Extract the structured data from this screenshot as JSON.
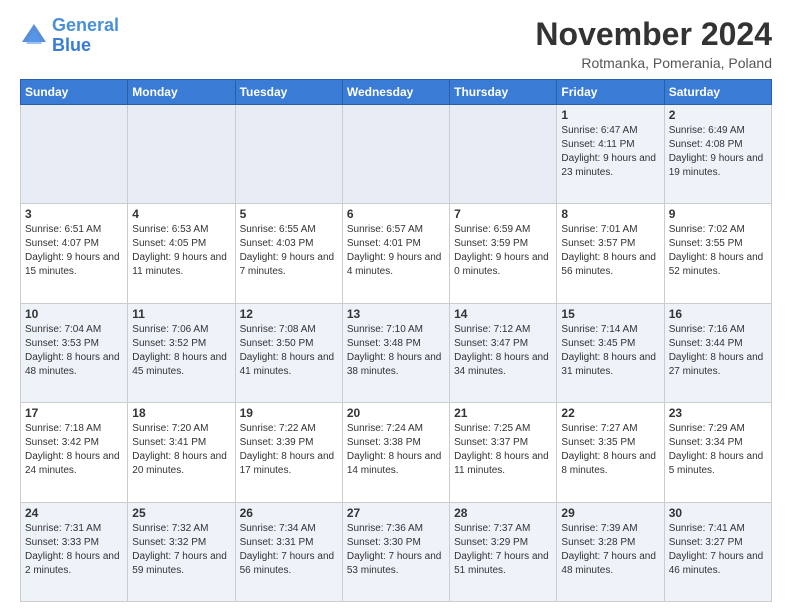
{
  "logo": {
    "line1": "General",
    "line2": "Blue"
  },
  "title": "November 2024",
  "subtitle": "Rotmanka, Pomerania, Poland",
  "weekdays": [
    "Sunday",
    "Monday",
    "Tuesday",
    "Wednesday",
    "Thursday",
    "Friday",
    "Saturday"
  ],
  "rows": [
    [
      {
        "day": "",
        "info": ""
      },
      {
        "day": "",
        "info": ""
      },
      {
        "day": "",
        "info": ""
      },
      {
        "day": "",
        "info": ""
      },
      {
        "day": "",
        "info": ""
      },
      {
        "day": "1",
        "info": "Sunrise: 6:47 AM\nSunset: 4:11 PM\nDaylight: 9 hours\nand 23 minutes."
      },
      {
        "day": "2",
        "info": "Sunrise: 6:49 AM\nSunset: 4:08 PM\nDaylight: 9 hours\nand 19 minutes."
      }
    ],
    [
      {
        "day": "3",
        "info": "Sunrise: 6:51 AM\nSunset: 4:07 PM\nDaylight: 9 hours\nand 15 minutes."
      },
      {
        "day": "4",
        "info": "Sunrise: 6:53 AM\nSunset: 4:05 PM\nDaylight: 9 hours\nand 11 minutes."
      },
      {
        "day": "5",
        "info": "Sunrise: 6:55 AM\nSunset: 4:03 PM\nDaylight: 9 hours\nand 7 minutes."
      },
      {
        "day": "6",
        "info": "Sunrise: 6:57 AM\nSunset: 4:01 PM\nDaylight: 9 hours\nand 4 minutes."
      },
      {
        "day": "7",
        "info": "Sunrise: 6:59 AM\nSunset: 3:59 PM\nDaylight: 9 hours\nand 0 minutes."
      },
      {
        "day": "8",
        "info": "Sunrise: 7:01 AM\nSunset: 3:57 PM\nDaylight: 8 hours\nand 56 minutes."
      },
      {
        "day": "9",
        "info": "Sunrise: 7:02 AM\nSunset: 3:55 PM\nDaylight: 8 hours\nand 52 minutes."
      }
    ],
    [
      {
        "day": "10",
        "info": "Sunrise: 7:04 AM\nSunset: 3:53 PM\nDaylight: 8 hours\nand 48 minutes."
      },
      {
        "day": "11",
        "info": "Sunrise: 7:06 AM\nSunset: 3:52 PM\nDaylight: 8 hours\nand 45 minutes."
      },
      {
        "day": "12",
        "info": "Sunrise: 7:08 AM\nSunset: 3:50 PM\nDaylight: 8 hours\nand 41 minutes."
      },
      {
        "day": "13",
        "info": "Sunrise: 7:10 AM\nSunset: 3:48 PM\nDaylight: 8 hours\nand 38 minutes."
      },
      {
        "day": "14",
        "info": "Sunrise: 7:12 AM\nSunset: 3:47 PM\nDaylight: 8 hours\nand 34 minutes."
      },
      {
        "day": "15",
        "info": "Sunrise: 7:14 AM\nSunset: 3:45 PM\nDaylight: 8 hours\nand 31 minutes."
      },
      {
        "day": "16",
        "info": "Sunrise: 7:16 AM\nSunset: 3:44 PM\nDaylight: 8 hours\nand 27 minutes."
      }
    ],
    [
      {
        "day": "17",
        "info": "Sunrise: 7:18 AM\nSunset: 3:42 PM\nDaylight: 8 hours\nand 24 minutes."
      },
      {
        "day": "18",
        "info": "Sunrise: 7:20 AM\nSunset: 3:41 PM\nDaylight: 8 hours\nand 20 minutes."
      },
      {
        "day": "19",
        "info": "Sunrise: 7:22 AM\nSunset: 3:39 PM\nDaylight: 8 hours\nand 17 minutes."
      },
      {
        "day": "20",
        "info": "Sunrise: 7:24 AM\nSunset: 3:38 PM\nDaylight: 8 hours\nand 14 minutes."
      },
      {
        "day": "21",
        "info": "Sunrise: 7:25 AM\nSunset: 3:37 PM\nDaylight: 8 hours\nand 11 minutes."
      },
      {
        "day": "22",
        "info": "Sunrise: 7:27 AM\nSunset: 3:35 PM\nDaylight: 8 hours\nand 8 minutes."
      },
      {
        "day": "23",
        "info": "Sunrise: 7:29 AM\nSunset: 3:34 PM\nDaylight: 8 hours\nand 5 minutes."
      }
    ],
    [
      {
        "day": "24",
        "info": "Sunrise: 7:31 AM\nSunset: 3:33 PM\nDaylight: 8 hours\nand 2 minutes."
      },
      {
        "day": "25",
        "info": "Sunrise: 7:32 AM\nSunset: 3:32 PM\nDaylight: 7 hours\nand 59 minutes."
      },
      {
        "day": "26",
        "info": "Sunrise: 7:34 AM\nSunset: 3:31 PM\nDaylight: 7 hours\nand 56 minutes."
      },
      {
        "day": "27",
        "info": "Sunrise: 7:36 AM\nSunset: 3:30 PM\nDaylight: 7 hours\nand 53 minutes."
      },
      {
        "day": "28",
        "info": "Sunrise: 7:37 AM\nSunset: 3:29 PM\nDaylight: 7 hours\nand 51 minutes."
      },
      {
        "day": "29",
        "info": "Sunrise: 7:39 AM\nSunset: 3:28 PM\nDaylight: 7 hours\nand 48 minutes."
      },
      {
        "day": "30",
        "info": "Sunrise: 7:41 AM\nSunset: 3:27 PM\nDaylight: 7 hours\nand 46 minutes."
      }
    ]
  ]
}
